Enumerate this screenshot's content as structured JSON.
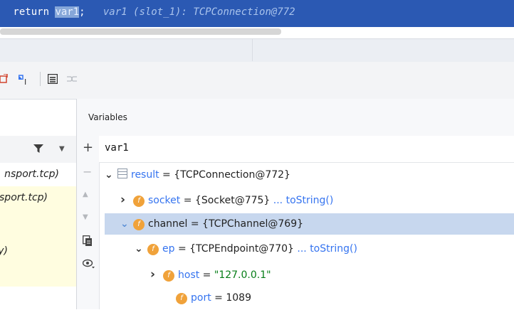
{
  "editor": {
    "code_prefix": " return ",
    "code_selected": "var1",
    "code_suffix": ";",
    "inline_hint": "   var1 (slot_1): TCPConnection@772"
  },
  "frames": {
    "rows": [
      "nsport.tcp)",
      "sport.tcp)",
      "y)"
    ]
  },
  "variables": {
    "title": "Variables",
    "watch_expression": "var1",
    "tree": [
      {
        "indent": 0,
        "arrow": "down",
        "icon": "object",
        "name": "result",
        "value": "{TCPConnection@772}",
        "suffix": "",
        "selected": false,
        "string": false
      },
      {
        "indent": 1,
        "arrow": "right",
        "icon": "field",
        "name": "socket",
        "value": "{Socket@775}",
        "suffix": " ... toString()",
        "selected": false,
        "string": false
      },
      {
        "indent": 1,
        "arrow": "down",
        "icon": "field",
        "name": "channel",
        "value": "{TCPChannel@769}",
        "suffix": "",
        "selected": true,
        "string": false
      },
      {
        "indent": 2,
        "arrow": "down",
        "icon": "field-static",
        "name": "ep",
        "value": "{TCPEndpoint@770}",
        "suffix": " ... toString()",
        "selected": false,
        "string": false
      },
      {
        "indent": 3,
        "arrow": "right",
        "icon": "field",
        "name": "host",
        "value": "\"127.0.0.1\"",
        "suffix": "",
        "selected": false,
        "string": true
      },
      {
        "indent": 3,
        "arrow": "none",
        "icon": "field",
        "name": "port",
        "value": "1089",
        "suffix": "",
        "selected": false,
        "string": false
      }
    ]
  },
  "icons": {
    "field_badge": "f",
    "filter": "filter-icon",
    "add": "+",
    "remove": "−"
  },
  "colors": {
    "editor_bg": "#2b59b3",
    "selection_row": "#c7d7ee",
    "field_badge": "#f0a23a",
    "var_name": "#3574f0",
    "string_value": "#067d17"
  }
}
